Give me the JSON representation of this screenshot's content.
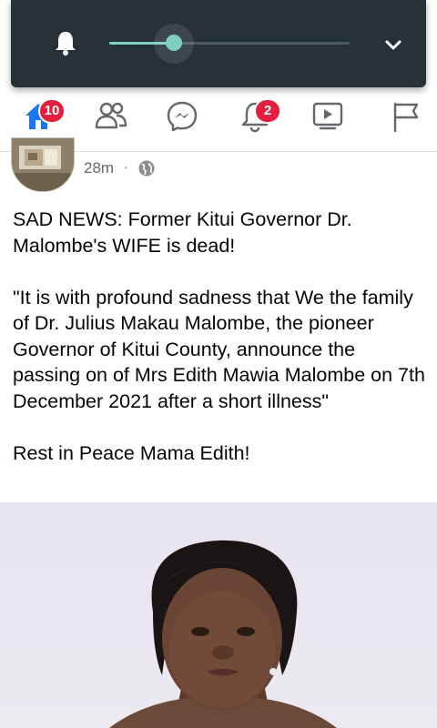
{
  "volume_panel": {
    "level_fraction": 0.27,
    "icons": {
      "bell": "bell-icon",
      "expand": "chevron-down-icon"
    }
  },
  "navbar": {
    "items": [
      {
        "name": "home",
        "icon": "home-icon",
        "badge": "10",
        "active": true
      },
      {
        "name": "friends",
        "icon": "friends-icon"
      },
      {
        "name": "messenger",
        "icon": "messenger-icon"
      },
      {
        "name": "notifications",
        "icon": "bell-icon",
        "badge": "2"
      },
      {
        "name": "watch",
        "icon": "video-icon"
      },
      {
        "name": "pages",
        "icon": "flag-icon"
      }
    ],
    "accent_color": "#1877f2",
    "badge_color": "#e41e3f"
  },
  "post": {
    "timestamp": "28m",
    "separator": "·",
    "privacy_icon": "globe-icon",
    "text": "SAD NEWS: Former Kitui Governor Dr. Malombe's WIFE is dead!\n\n\"It is with profound sadness that We the family of Dr. Julius Makau Malombe, the pioneer Governor of Kitui County, announce the passing on of Mrs Edith Mawia Malombe on 7th December 2021 after a short illness\"\n\nRest in Peace Mama Edith!"
  }
}
